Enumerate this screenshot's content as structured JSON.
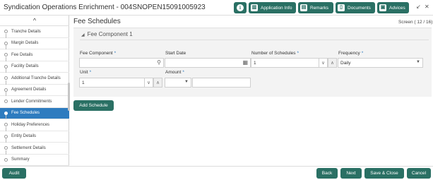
{
  "header": {
    "title": "Syndication Operations Enrichment - 004SNOPEN15091005923",
    "buttons": {
      "info": "i",
      "application_info": "Application Info",
      "remarks": "Remarks",
      "documents": "Documents",
      "advices": "Advices"
    },
    "minimize_glyph": "↙",
    "close_glyph": "✕"
  },
  "sidebar": {
    "collapse_glyph": "^",
    "items": [
      {
        "label": "Tranche Details"
      },
      {
        "label": "Margin Details"
      },
      {
        "label": "Fee Details"
      },
      {
        "label": "Facility Details"
      },
      {
        "label": "Additional Tranche Details"
      },
      {
        "label": "Agreement Details"
      },
      {
        "label": "Lender Commitments"
      },
      {
        "label": "Fee Schedules"
      },
      {
        "label": "Holiday Preferences"
      },
      {
        "label": "Entity Details"
      },
      {
        "label": "Settlement Details"
      },
      {
        "label": "Summary"
      }
    ],
    "active_index": 7
  },
  "main": {
    "title": "Fee Schedules",
    "screen_indicator": "Screen ( 12 / 16)",
    "section_title": "Fee Component 1",
    "fields": {
      "fee_component": {
        "label": "Fee Component",
        "value": ""
      },
      "start_date": {
        "label": "Start Date",
        "value": ""
      },
      "number_of_schedules": {
        "label": "Number of Schedules",
        "value": "1"
      },
      "frequency": {
        "label": "Frequency",
        "value": "Daily"
      },
      "unit": {
        "label": "Unit",
        "value": "1"
      },
      "amount": {
        "label": "Amount",
        "currency": "",
        "value": ""
      }
    },
    "add_schedule_label": "Add Schedule"
  },
  "footer": {
    "audit": "Audit",
    "back": "Back",
    "next": "Next",
    "save_close": "Save & Close",
    "cancel": "Cancel"
  },
  "colors": {
    "accent": "#2a7064",
    "active_nav": "#2e7cbf",
    "required_marker": "#2e7cbf"
  }
}
